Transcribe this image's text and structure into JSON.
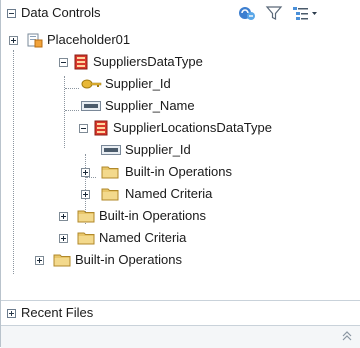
{
  "panel": {
    "title": "Data Controls",
    "toolbar": {
      "refresh_icon": "refresh-icon",
      "filter_icon": "filter-icon",
      "menu_icon": "view-menu-icon"
    }
  },
  "tree": {
    "items": [
      {
        "label": "Placeholder01"
      },
      {
        "label": "SuppliersDataType"
      },
      {
        "label": "Supplier_Id"
      },
      {
        "label": "Supplier_Name"
      },
      {
        "label": "SupplierLocationsDataType"
      },
      {
        "label": "Supplier_Id"
      },
      {
        "label": "Built-in Operations"
      },
      {
        "label": "Named Criteria"
      },
      {
        "label": "Built-in Operations"
      },
      {
        "label": "Named Criteria"
      },
      {
        "label": "Built-in Operations"
      }
    ]
  },
  "recent_files": {
    "title": "Recent Files"
  },
  "colors": {
    "folder": "#e8c66a",
    "datatype_red": "#d9382b",
    "key_gold": "#d9a628",
    "border": "#c9d2da"
  }
}
